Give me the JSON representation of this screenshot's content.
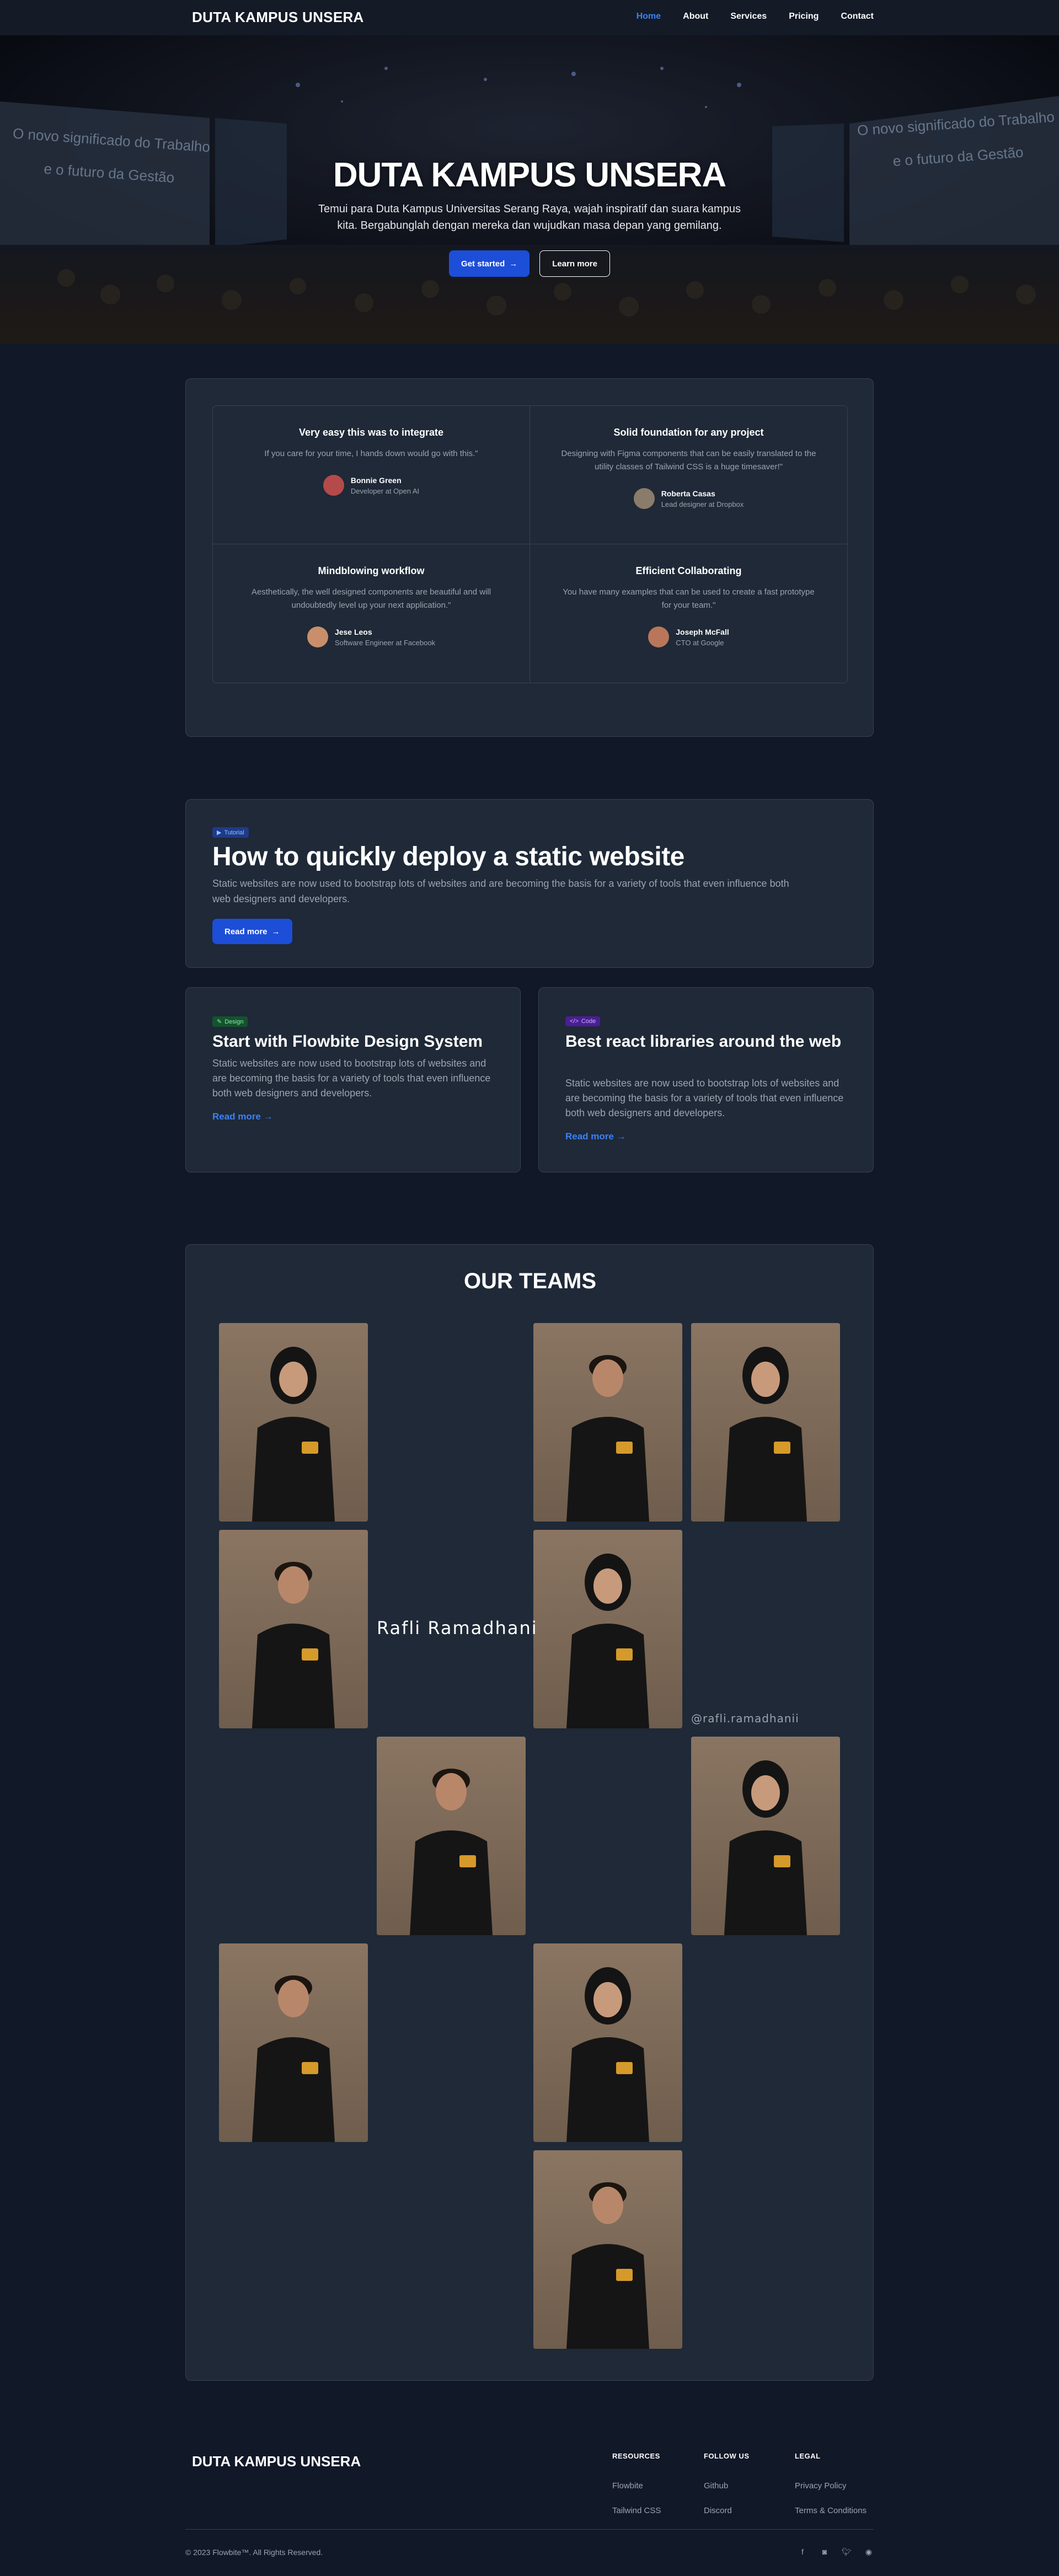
{
  "nav": {
    "brand": "DUTA KAMPUS UNSERA",
    "links": [
      "Home",
      "About",
      "Services",
      "Pricing",
      "Contact"
    ],
    "active": "Home"
  },
  "hero": {
    "title": "DUTA KAMPUS UNSERA",
    "subtitle": "Temui para Duta Kampus Universitas Serang Raya, wajah inspiratif dan suara kampus kita. Bergabunglah dengan mereka dan wujudkan masa depan yang gemilang.",
    "primary_button": "Get started",
    "secondary_button": "Learn more",
    "screen_text": [
      "O novo significado do Trabalho",
      "e o futuro da Gestão"
    ]
  },
  "testimonials": [
    {
      "title": "Very easy this was to integrate",
      "text": "If you care for your time, I hands down would go with this.\"",
      "name": "Bonnie Green",
      "role": "Developer at Open AI"
    },
    {
      "title": "Solid foundation for any project",
      "text": "Designing with Figma components that can be easily translated to the utility classes of Tailwind CSS is a huge timesaver!\"",
      "name": "Roberta Casas",
      "role": "Lead designer at Dropbox"
    },
    {
      "title": "Mindblowing workflow",
      "text": "Aesthetically, the well designed components are beautiful and will undoubtedly level up your next application.\"",
      "name": "Jese Leos",
      "role": "Software Engineer at Facebook"
    },
    {
      "title": "Efficient Collaborating",
      "text": "You have many examples that can be used to create a fast prototype for your team.\"",
      "name": "Joseph McFall",
      "role": "CTO at Google"
    }
  ],
  "feature_post": {
    "tag": "Tutorial",
    "title": "How to quickly deploy a static website",
    "text": "Static websites are now used to bootstrap lots of websites and are becoming the basis for a variety of tools that even influence both web designers and developers.",
    "button": "Read more"
  },
  "posts": [
    {
      "tag": "Design",
      "title": "Start with Flowbite Design System",
      "text": "Static websites are now used to bootstrap lots of websites and are becoming the basis for a variety of tools that even influence both web designers and developers.",
      "link": "Read more"
    },
    {
      "tag": "Code",
      "title": "Best react libraries around the web",
      "text": "Static websites are now used to bootstrap lots of websites and are becoming the basis for a variety of tools that even influence both web designers and developers.",
      "link": "Read more"
    }
  ],
  "teams": {
    "title": "OUR TEAMS",
    "featured_name": "Rafli Ramadhani",
    "featured_handle": "@rafli.ramadhanii",
    "photo_count": 11
  },
  "footer": {
    "brand": "DUTA KAMPUS UNSERA",
    "columns": [
      {
        "heading": "RESOURCES",
        "links": [
          "Flowbite",
          "Tailwind CSS"
        ]
      },
      {
        "heading": "FOLLOW US",
        "links": [
          "Github",
          "Discord"
        ]
      },
      {
        "heading": "LEGAL",
        "links": [
          "Privacy Policy",
          "Terms & Conditions"
        ]
      }
    ],
    "copyright": "© 2023 Flowbite™. All Rights Reserved.",
    "socials": [
      "facebook-icon",
      "discord-icon",
      "twitter-icon",
      "github-icon"
    ]
  },
  "colors": {
    "background": "#111827",
    "card": "#1f2937",
    "accent": "#1d4ed8",
    "link": "#3b82f6"
  }
}
